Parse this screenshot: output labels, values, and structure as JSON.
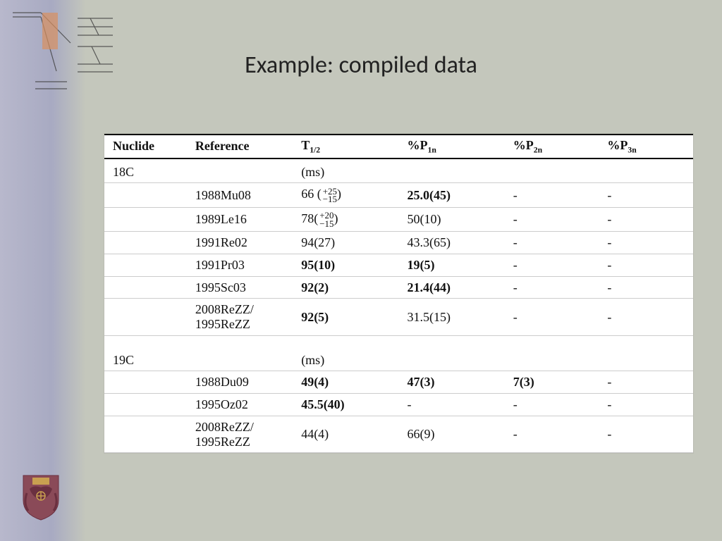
{
  "title": "Example: compiled data",
  "headers": {
    "nuclide": "Nuclide",
    "reference": "Reference",
    "t12_label": "T",
    "t12_sub": "1/2",
    "p1n": "%P",
    "p1n_sub": "1n",
    "p2n": "%P",
    "p2n_sub": "2n",
    "p3n": "%P",
    "p3n_sub": "3n"
  },
  "groups": [
    {
      "nuclide": "18C",
      "unit": "(ms)",
      "rows": [
        {
          "ref": "1988Mu08",
          "t12": "66 ",
          "t12_up": "+25",
          "t12_dn": "−15",
          "t12_paren": true,
          "t12_bold": false,
          "p1n": "25.0(45)",
          "p1n_bold": true,
          "p2n": "-",
          "p2n_bold": false,
          "p3n": "-"
        },
        {
          "ref": "1989Le16",
          "t12": "78",
          "t12_up": "+20",
          "t12_dn": "−15",
          "t12_paren": true,
          "t12_bold": false,
          "p1n": "50(10)",
          "p1n_bold": false,
          "p2n": "-",
          "p2n_bold": false,
          "p3n": "-"
        },
        {
          "ref": "1991Re02",
          "t12": "94(27)",
          "t12_up": "",
          "t12_dn": "",
          "t12_paren": false,
          "t12_bold": false,
          "p1n": "43.3(65)",
          "p1n_bold": false,
          "p2n": "-",
          "p2n_bold": false,
          "p3n": "-"
        },
        {
          "ref": "1991Pr03",
          "t12": "95(10)",
          "t12_up": "",
          "t12_dn": "",
          "t12_paren": false,
          "t12_bold": true,
          "p1n": "19(5)",
          "p1n_bold": true,
          "p2n": "-",
          "p2n_bold": false,
          "p3n": "-"
        },
        {
          "ref": "1995Sc03",
          "t12": "92(2)",
          "t12_up": "",
          "t12_dn": "",
          "t12_paren": false,
          "t12_bold": true,
          "p1n": "21.4(44)",
          "p1n_bold": true,
          "p2n": "-",
          "p2n_bold": false,
          "p3n": "-"
        },
        {
          "ref": "2008ReZZ/\n1995ReZZ",
          "t12": "92(5)",
          "t12_up": "",
          "t12_dn": "",
          "t12_paren": false,
          "t12_bold": true,
          "p1n": "31.5(15)",
          "p1n_bold": false,
          "p2n": "-",
          "p2n_bold": false,
          "p3n": "-"
        }
      ]
    },
    {
      "nuclide": "19C",
      "unit": "(ms)",
      "rows": [
        {
          "ref": "1988Du09",
          "t12": "49(4)",
          "t12_up": "",
          "t12_dn": "",
          "t12_paren": false,
          "t12_bold": true,
          "p1n": "47(3)",
          "p1n_bold": true,
          "p2n": "7(3)",
          "p2n_bold": true,
          "p3n": "-"
        },
        {
          "ref": "1995Oz02",
          "t12": "45.5(40)",
          "t12_up": "",
          "t12_dn": "",
          "t12_paren": false,
          "t12_bold": true,
          "p1n": "-",
          "p1n_bold": false,
          "p2n": "-",
          "p2n_bold": false,
          "p3n": "-"
        },
        {
          "ref": "2008ReZZ/\n1995ReZZ",
          "t12": "44(4)",
          "t12_up": "",
          "t12_dn": "",
          "t12_paren": false,
          "t12_bold": false,
          "p1n": "66(9)",
          "p1n_bold": false,
          "p2n": "-",
          "p2n_bold": false,
          "p3n": "-"
        }
      ]
    }
  ]
}
